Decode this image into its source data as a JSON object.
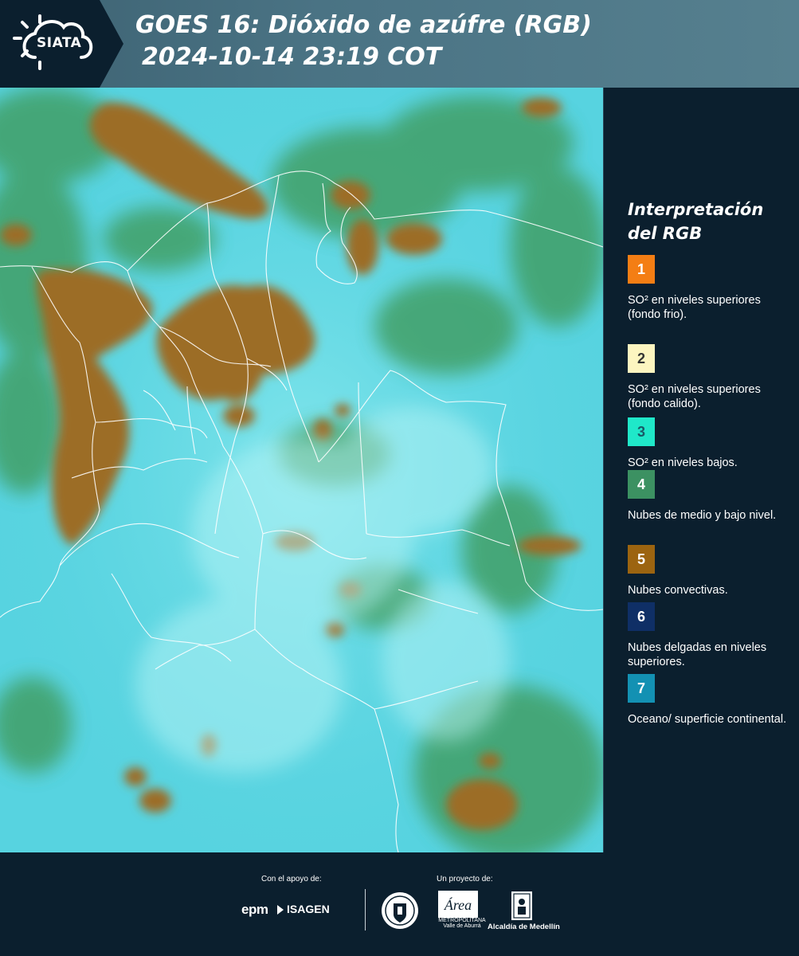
{
  "header": {
    "logo_text": "SIATA",
    "title_line1": "GOES 16: Dióxido de azúfre (RGB)",
    "title_line2": "2024-10-14 23:19 COT"
  },
  "legend": {
    "title_line1": "Interpretación",
    "title_line2": "del RGB",
    "items": [
      {
        "number": "1",
        "color": "#f47e14",
        "text_color": "#ffffff",
        "description": "SO² en niveles superiores (fondo frio)."
      },
      {
        "number": "2",
        "color": "#fdf5c0",
        "text_color": "#333333",
        "description": "SO² en niveles superiores (fondo calido)."
      },
      {
        "number": "3",
        "color": "#1fe8c9",
        "text_color": "#1a5a66",
        "description": "SO² en niveles bajos."
      },
      {
        "number": "4",
        "color": "#3c9162",
        "text_color": "#ffffff",
        "description": "Nubes de medio y bajo nivel."
      },
      {
        "number": "5",
        "color": "#9c6410",
        "text_color": "#ffffff",
        "description": "Nubes convectivas."
      },
      {
        "number": "6",
        "color": "#0f2f66",
        "text_color": "#ffffff",
        "description": "Nubes delgadas en niveles superiores."
      },
      {
        "number": "7",
        "color": "#1391b3",
        "text_color": "#ffffff",
        "description": "Oceano/ superficie continental."
      }
    ]
  },
  "footer": {
    "support_label": "Con el apoyo de:",
    "project_label": "Un proyecto de:",
    "epm": "epm",
    "isagen": "ISAGEN",
    "amva_name": "Área",
    "amva_sub": "METROPOLITANA Valle de Aburrá",
    "alcaldia": "Alcaldía de Medellín"
  },
  "map_colors": {
    "base": "#5ed8e3",
    "convective": "#9a6c2a",
    "low_cloud": "#3d9a60",
    "borders": "#ffffff"
  }
}
